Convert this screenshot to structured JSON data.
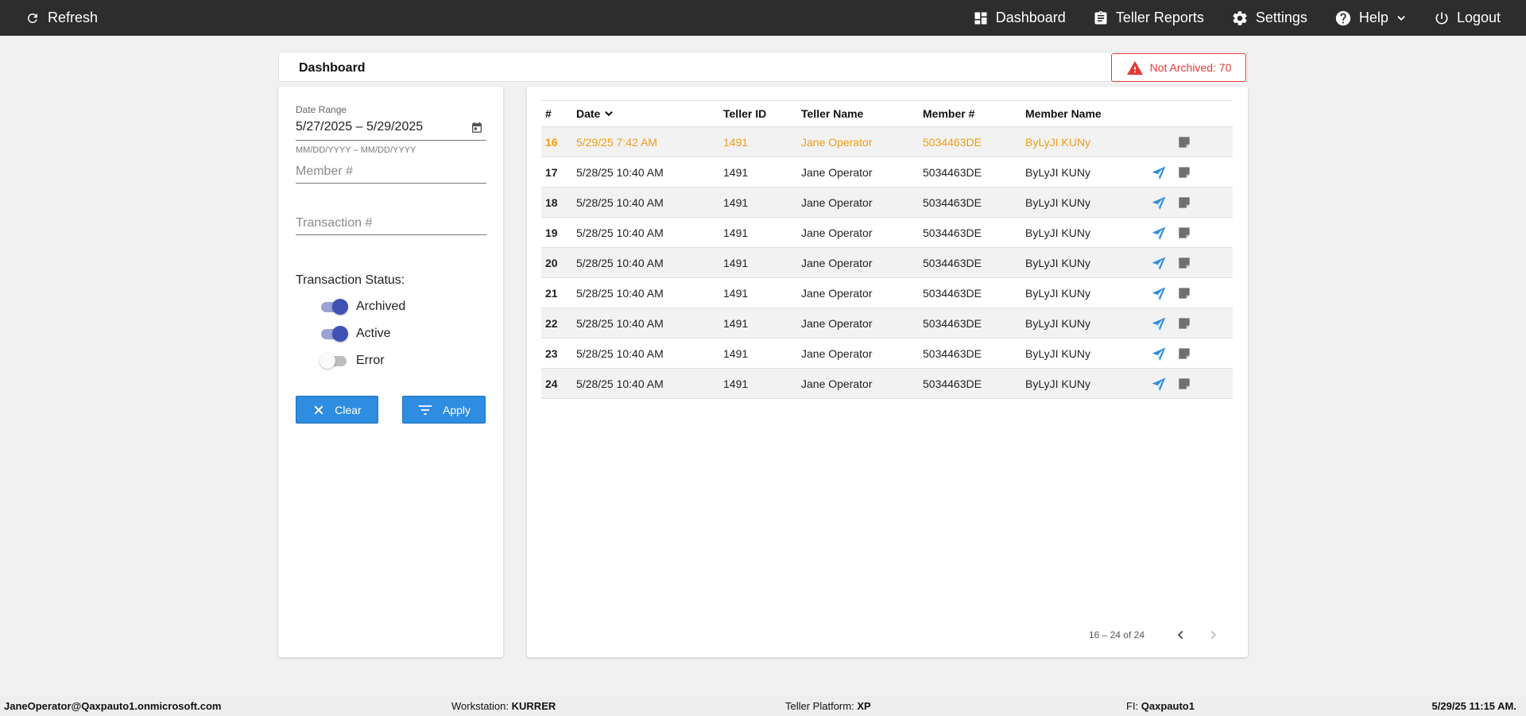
{
  "topbar": {
    "refresh_label": "Refresh",
    "nav": [
      {
        "label": "Dashboard",
        "icon": "dashboard-icon"
      },
      {
        "label": "Teller Reports",
        "icon": "clipboard-icon"
      },
      {
        "label": "Settings",
        "icon": "gear-icon"
      },
      {
        "label": "Help",
        "icon": "help-icon"
      },
      {
        "label": "Logout",
        "icon": "power-icon"
      }
    ]
  },
  "header": {
    "title": "Dashboard",
    "not_archived_label": "Not Archived: 70"
  },
  "filters": {
    "date_range_label": "Date Range",
    "date_range_value": "5/27/2025 – 5/29/2025",
    "date_hint": "MM/DD/YYYY – MM/DD/YYYY",
    "member_placeholder": "Member #",
    "transaction_placeholder": "Transaction #",
    "status_label": "Transaction Status:",
    "toggles": [
      {
        "label": "Archived",
        "on": true
      },
      {
        "label": "Active",
        "on": true
      },
      {
        "label": "Error",
        "on": false
      }
    ],
    "clear_label": "Clear",
    "apply_label": "Apply"
  },
  "table": {
    "columns": [
      "#",
      "Date",
      "Teller ID",
      "Teller Name",
      "Member #",
      "Member Name"
    ],
    "rows": [
      {
        "num": "16",
        "date": "5/29/25 7:42 AM",
        "teller_id": "1491",
        "teller_name": "Jane Operator",
        "member_num": "5034463DE",
        "member_name": "ByLyJI KUNy",
        "highlight": true,
        "send": false
      },
      {
        "num": "17",
        "date": "5/28/25 10:40 AM",
        "teller_id": "1491",
        "teller_name": "Jane Operator",
        "member_num": "5034463DE",
        "member_name": "ByLyJI KUNy",
        "highlight": false,
        "send": true
      },
      {
        "num": "18",
        "date": "5/28/25 10:40 AM",
        "teller_id": "1491",
        "teller_name": "Jane Operator",
        "member_num": "5034463DE",
        "member_name": "ByLyJI KUNy",
        "highlight": false,
        "send": true
      },
      {
        "num": "19",
        "date": "5/28/25 10:40 AM",
        "teller_id": "1491",
        "teller_name": "Jane Operator",
        "member_num": "5034463DE",
        "member_name": "ByLyJI KUNy",
        "highlight": false,
        "send": true
      },
      {
        "num": "20",
        "date": "5/28/25 10:40 AM",
        "teller_id": "1491",
        "teller_name": "Jane Operator",
        "member_num": "5034463DE",
        "member_name": "ByLyJI KUNy",
        "highlight": false,
        "send": true
      },
      {
        "num": "21",
        "date": "5/28/25 10:40 AM",
        "teller_id": "1491",
        "teller_name": "Jane Operator",
        "member_num": "5034463DE",
        "member_name": "ByLyJI KUNy",
        "highlight": false,
        "send": true
      },
      {
        "num": "22",
        "date": "5/28/25 10:40 AM",
        "teller_id": "1491",
        "teller_name": "Jane Operator",
        "member_num": "5034463DE",
        "member_name": "ByLyJI KUNy",
        "highlight": false,
        "send": true
      },
      {
        "num": "23",
        "date": "5/28/25 10:40 AM",
        "teller_id": "1491",
        "teller_name": "Jane Operator",
        "member_num": "5034463DE",
        "member_name": "ByLyJI KUNy",
        "highlight": false,
        "send": true
      },
      {
        "num": "24",
        "date": "5/28/25 10:40 AM",
        "teller_id": "1491",
        "teller_name": "Jane Operator",
        "member_num": "5034463DE",
        "member_name": "ByLyJI KUNy",
        "highlight": false,
        "send": true
      }
    ],
    "pagination": "16 – 24 of 24"
  },
  "statusbar": {
    "user": "JaneOperator@Qaxpauto1.onmicrosoft.com",
    "workstation_label": "Workstation:",
    "workstation_value": "KURRER",
    "platform_label": "Teller Platform:",
    "platform_value": "XP",
    "fi_label": "FI:",
    "fi_value": "Qaxpauto1",
    "datetime": "5/29/25 11:15 AM."
  },
  "colors": {
    "topbar": "#2d2d2d",
    "accent_blue": "#2e8de0",
    "highlight_orange": "#f39c12",
    "alert_red": "#e53935",
    "toggle_indigo": "#3f51b5"
  }
}
